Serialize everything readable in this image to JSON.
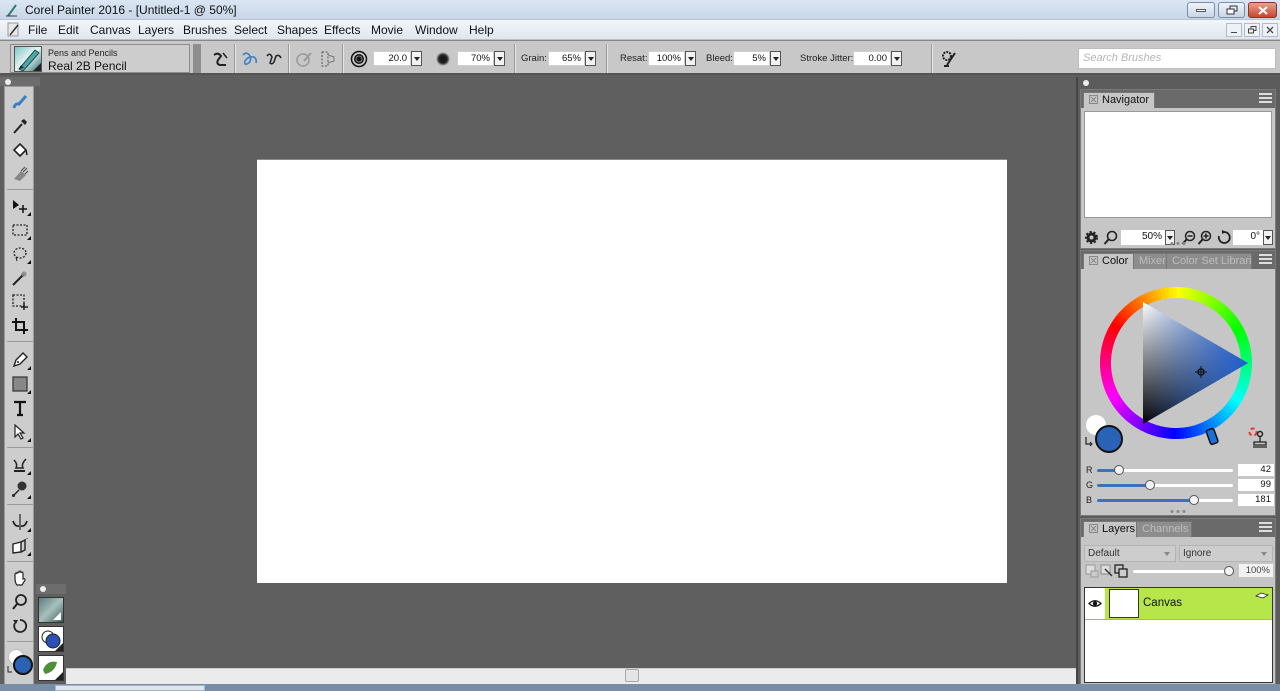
{
  "window": {
    "title": "Corel Painter 2016 - [Untitled-1 @ 50%]",
    "controls": [
      "minimize",
      "restore",
      "close"
    ]
  },
  "menu": {
    "items": [
      "File",
      "Edit",
      "Canvas",
      "Layers",
      "Brushes",
      "Select",
      "Shapes",
      "Effects",
      "Movie",
      "Window",
      "Help"
    ],
    "doc_controls": [
      "_",
      "restore",
      "×"
    ]
  },
  "property_bar": {
    "brush_category": "Pens and Pencils",
    "brush_variant": "Real 2B Pencil",
    "size": "20.0",
    "opacity": "70%",
    "grain_label": "Grain:",
    "grain": "65%",
    "resat_label": "Resat:",
    "resat": "100%",
    "bleed_label": "Bleed:",
    "bleed": "5%",
    "jitter_label": "Stroke Jitter:",
    "jitter": "0.00",
    "icons": [
      "reset-tool-icon",
      "freehand-stroke-icon",
      "straight-line-stroke-icon",
      "stroke-attributes-icon",
      "transform-icon",
      "size-icon",
      "opacity-icon",
      "brush-settings-icon"
    ]
  },
  "search": {
    "placeholder": "Search Brushes"
  },
  "toolbox": {
    "tools": [
      "brush",
      "dropper",
      "paint-bucket",
      "eraser",
      "layer-adjuster",
      "rectangular-selection",
      "lasso",
      "magic-wand",
      "transform",
      "crop",
      "pen",
      "rectangle",
      "text",
      "shape-selection",
      "cloner",
      "dodge",
      "mirror",
      "perspective-grid",
      "grabber",
      "magnifier",
      "rotate-page"
    ]
  },
  "colors": {
    "main": "#2a63b5",
    "additional": "#ffffff",
    "layer_highlight": "#b7e64b",
    "slider_fill": "#3c72b8"
  },
  "navigator": {
    "tab": "Navigator",
    "zoom": "50%",
    "rotation": "0°"
  },
  "color_panel": {
    "tabs": [
      "Color",
      "Mixer",
      "Color Set Librari"
    ],
    "active_tab": "Color",
    "rgb": {
      "r_label": "R",
      "r": "42",
      "g_label": "G",
      "g": "99",
      "b_label": "B",
      "b": "181"
    },
    "rgb_fraction": {
      "r": 0.165,
      "g": 0.388,
      "b": 0.71
    }
  },
  "layers_panel": {
    "tabs": [
      "Layers",
      "Channels"
    ],
    "active_tab": "Layers",
    "composite_method": "Default",
    "composite_depth": "Ignore",
    "opacity": "100%",
    "opacity_fraction": 1.0,
    "layers": [
      {
        "name": "Canvas",
        "visible": true,
        "selected": true
      }
    ]
  }
}
